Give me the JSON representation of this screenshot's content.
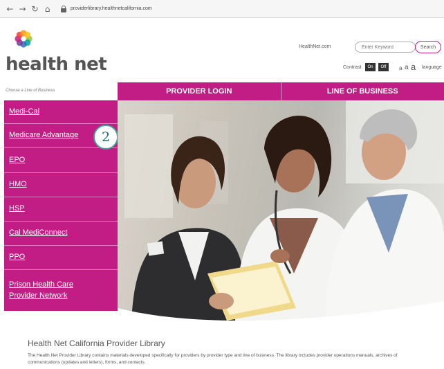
{
  "browser": {
    "back_icon": "arrow-left-icon",
    "forward_icon": "arrow-right-icon",
    "reload_icon": "reload-icon",
    "home_icon": "home-icon",
    "url": "providerlibrary.healthnetcalifornia.com"
  },
  "header": {
    "logo_text": "health net",
    "healthnet_link": "HealthNet.com",
    "search_placeholder": "Enter Keyword",
    "search_button": "Search",
    "contrast_label": "Contrast",
    "contrast_on": "On",
    "contrast_off": "Off",
    "font_sizes": [
      "a",
      "a",
      "a"
    ],
    "language_label": "language"
  },
  "nav": {
    "choose_label": "Choose a Line of Business",
    "tabs": [
      "PROVIDER LOGIN",
      "LINE OF BUSINESS"
    ]
  },
  "sidebar": {
    "items": [
      {
        "label": "Medi-Cal"
      },
      {
        "label": "Medicare Advantage"
      },
      {
        "label": "EPO"
      },
      {
        "label": "HMO"
      },
      {
        "label": "HSP"
      },
      {
        "label": "Cal MediConnect"
      },
      {
        "label": "PPO"
      },
      {
        "label": "Prison Health Care",
        "label2": "Provider Network"
      }
    ]
  },
  "callout": {
    "number": "2"
  },
  "library": {
    "title": "Health Net California Provider Library",
    "description": "The Health Net Provider Library contains materials developed specifically for providers by provider type and line of business. The library includes provider operations manuals, archives of communications (updates and letters), forms, and contacts."
  },
  "colors": {
    "brand_magenta": "#c21d85",
    "callout_teal": "#3aa39a"
  }
}
